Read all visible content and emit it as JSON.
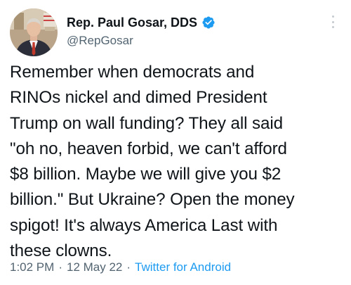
{
  "author": {
    "display_name": "Rep. Paul Gosar, DDS",
    "handle": "@RepGosar",
    "verified": true,
    "verified_icon": "verified-badge-icon",
    "avatar_icon": "profile-photo"
  },
  "tweet": {
    "text": "Remember when democrats and\nRINOs nickel and dimed President\nTrump on wall funding? They all said\n\"oh no, heaven forbid, we can't afford\n$8 billion. Maybe we will give you $2\nbillion.\" But Ukraine? Open the money\nspigot! It's always America Last with\nthese clowns."
  },
  "meta": {
    "time": "1:02 PM",
    "separator": "·",
    "date": "12 May 22",
    "source": "Twitter for Android"
  },
  "colors": {
    "text": "#0f1419",
    "secondary": "#536471",
    "accent": "#1d9bf0"
  },
  "menu": {
    "more_icon": "more-vertical-icon"
  }
}
